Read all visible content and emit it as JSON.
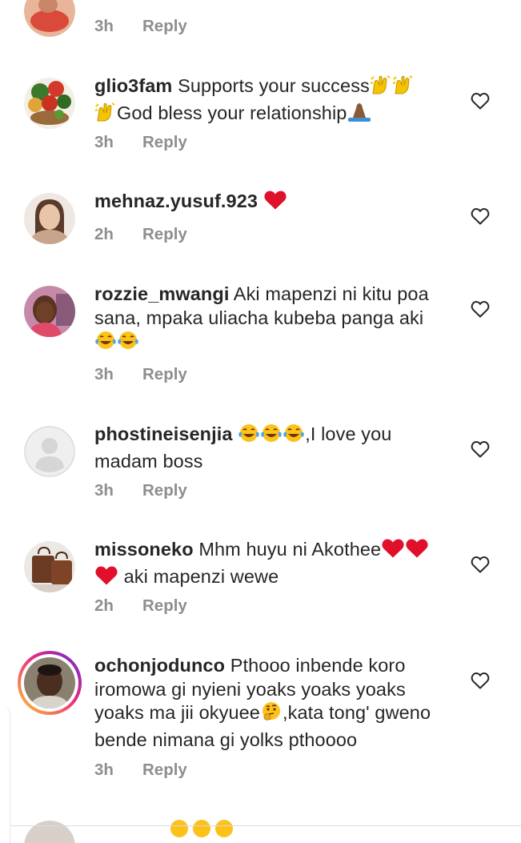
{
  "comments": [
    {
      "username": "",
      "text": "",
      "time": "3h",
      "reply": "Reply"
    },
    {
      "username": "glio3fam",
      "text": "Supports your success",
      "text_cont": "God bless your relationship",
      "time": "3h",
      "reply": "Reply",
      "emojis": [
        "raising-hands",
        "raising-hands",
        "raising-hands",
        "folded-hands"
      ]
    },
    {
      "username": "mehnaz.yusuf.923",
      "text": "",
      "time": "2h",
      "reply": "Reply",
      "emojis": [
        "red-heart"
      ]
    },
    {
      "username": "rozzie_mwangi",
      "text": "Aki mapenzi ni kitu poa sana, mpaka uliacha kubeba panga aki",
      "time": "3h",
      "reply": "Reply",
      "emojis": [
        "tears-of-joy",
        "tears-of-joy"
      ]
    },
    {
      "username": "phostineisenjia",
      "text": ",I love you madam boss",
      "time": "3h",
      "reply": "Reply",
      "emojis": [
        "tears-of-joy",
        "tears-of-joy",
        "tears-of-joy"
      ]
    },
    {
      "username": "missoneko",
      "text": "Mhm huyu ni Akothee",
      "text_cont": "aki mapenzi wewe",
      "time": "2h",
      "reply": "Reply",
      "emojis": [
        "red-heart",
        "red-heart",
        "red-heart"
      ]
    },
    {
      "username": "ochonjodunco",
      "text": "Pthooo inbende koro iromowa gi nyieni yoaks yoaks yoaks yoaks ma jii okyuee",
      "text_cont": ",kata tong' gweno bende nimana gi yolks pthoooo",
      "time": "3h",
      "reply": "Reply",
      "emojis": [
        "thinking-face"
      ]
    }
  ],
  "colors": {
    "text": "#262626",
    "meta": "#8e8e8e",
    "heart": "#262626"
  }
}
